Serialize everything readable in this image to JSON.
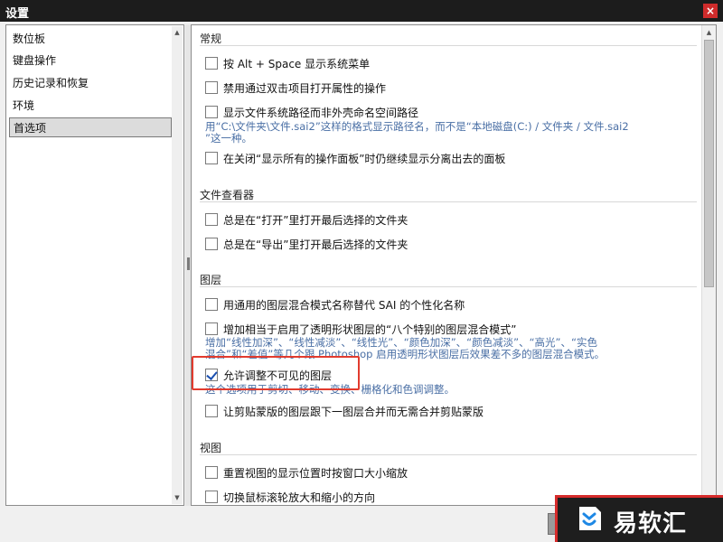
{
  "window": {
    "title": "设置",
    "close_symbol": "×"
  },
  "sidebar": {
    "items": [
      {
        "label": "数位板",
        "selected": false
      },
      {
        "label": "键盘操作",
        "selected": false
      },
      {
        "label": "历史记录和恢复",
        "selected": false
      },
      {
        "label": "环境",
        "selected": false
      },
      {
        "label": "首选项",
        "selected": true
      }
    ]
  },
  "sections": {
    "general": {
      "heading": "常规",
      "options": [
        {
          "label": "按 Alt + Space 显示系统菜单",
          "checked": false
        },
        {
          "label": "禁用通过双击项目打开属性的操作",
          "checked": false
        },
        {
          "label": "显示文件系统路径而非外壳命名空间路径",
          "checked": false
        },
        {
          "label": "在关闭“显示所有的操作面板”时仍继续显示分离出去的面板",
          "checked": false
        }
      ],
      "desc_path_line1": "用“C:\\文件夹\\文件.sai2”这样的格式显示路径名，而不是“本地磁盘(C:) / 文件夹 / 文件.sai2",
      "desc_path_line2": "”这一种。"
    },
    "file_viewer": {
      "heading": "文件查看器",
      "options": [
        {
          "label": "总是在“打开”里打开最后选择的文件夹",
          "checked": false
        },
        {
          "label": "总是在“导出”里打开最后选择的文件夹",
          "checked": false
        }
      ]
    },
    "layers": {
      "heading": "图层",
      "options": [
        {
          "label": "用通用的图层混合模式名称替代 SAI 的个性化名称",
          "checked": false
        },
        {
          "label": "增加相当于启用了透明形状图层的“八个特别的图层混合模式”",
          "checked": false
        },
        {
          "label": "允许调整不可见的图层",
          "checked": true
        },
        {
          "label": "让剪贴蒙版的图层跟下一图层合并而无需合并剪贴蒙版",
          "checked": false
        }
      ],
      "desc_blend_line1": "增加“线性加深”、“线性减淡”、“线性光”、“颜色加深”、“颜色减淡”、“高光”、“实色",
      "desc_blend_line2": "混合”和“差值”等几个跟 Photoshop 启用透明形状图层后效果差不多的图层混合模式。",
      "desc_invisible": "这个选项用于剪切、移动、变换、栅格化和色调调整。"
    },
    "view": {
      "heading": "视图",
      "options": [
        {
          "label": "重置视图的显示位置时按窗口大小缩放",
          "checked": false
        },
        {
          "label": "切换鼠标滚轮放大和缩小的方向",
          "checked": false
        }
      ]
    }
  },
  "watermark": {
    "brand": "易软汇"
  },
  "colors": {
    "title_bg": "#1c1c1c",
    "close_bg": "#cf2b2b",
    "desc_text": "#4a6fa5",
    "highlight": "#e23b2e",
    "check": "#1a4fb0"
  }
}
